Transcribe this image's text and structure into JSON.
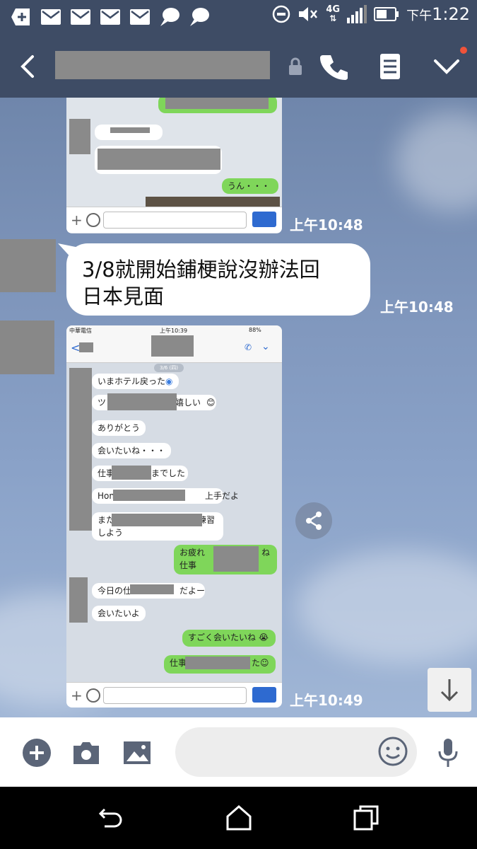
{
  "status_bar": {
    "time_prefix": "下午",
    "time": "1:22",
    "network": "4G",
    "left_icons": [
      "notification-plus-icon",
      "mail-icon",
      "mail-icon",
      "mail-icon",
      "mail-icon",
      "speech-bubble-icon",
      "speech-bubble-icon"
    ]
  },
  "header": {
    "lock_icon": "lock-icon",
    "call_icon": "phone-icon",
    "notes_icon": "notes-icon",
    "menu_icon": "chevron-down-icon",
    "badge_color": "#f0533a"
  },
  "messages": [
    {
      "type": "image",
      "timestamp": "上午10:48",
      "content": {
        "bubbles": [
          "うん・・・"
        ]
      }
    },
    {
      "type": "text",
      "text_line1": "3/8就開始鋪梗說沒辦法回",
      "text_line2": "日本見面",
      "timestamp": "上午10:48"
    },
    {
      "type": "image",
      "timestamp": "上午10:49",
      "content": {
        "status_time": "上午10:39",
        "carrier": "中華電信",
        "battery": "88%",
        "date_pill": "3/6 (四)",
        "bubbles_left": [
          "いまホテル戻った",
          "ツ",
          "嬉しい",
          "ありがとう",
          "会いたいね・・・",
          "仕事",
          "までした",
          "Hon",
          "上手だよ",
          "また",
          "練習",
          "しよう",
          "今日の仕",
          "だよー",
          "会いたいよ"
        ],
        "bubbles_right": [
          "お疲れ",
          "ね",
          "仕事",
          "すごく会いたいね",
          "仕事",
          "た"
        ]
      }
    }
  ],
  "input": {
    "placeholder": ""
  },
  "colors": {
    "header_bg": "#3e4c65",
    "bubble_green": "#7fd65a",
    "mic_blue": "#2e6ad0"
  }
}
